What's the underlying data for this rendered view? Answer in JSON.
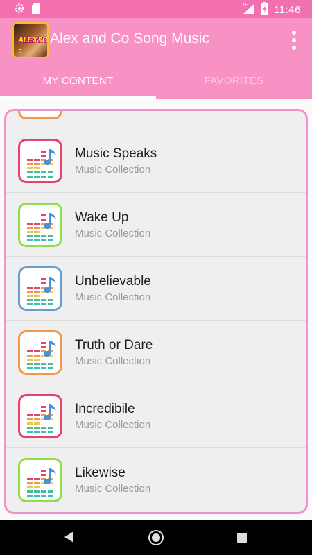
{
  "status_bar": {
    "time": "11:46",
    "network_label": "LTE",
    "icons": [
      "gear-icon",
      "sd-card-icon",
      "lte-signal-icon",
      "battery-charging-icon"
    ]
  },
  "app_bar": {
    "title": "Alex and Co Song Music",
    "logo_text": "ALEX&CO",
    "logo_note": "♫"
  },
  "tabs": [
    {
      "label": "MY CONTENT",
      "active": true
    },
    {
      "label": "FAVORITES",
      "active": false
    }
  ],
  "songs": [
    {
      "title": "Music Speaks",
      "subtitle": "Music Collection",
      "border_color": "#e8426b"
    },
    {
      "title": "Wake Up",
      "subtitle": "Music Collection",
      "border_color": "#8ee04a"
    },
    {
      "title": "Unbelievable",
      "subtitle": "Music Collection",
      "border_color": "#6b9ed0"
    },
    {
      "title": "Truth or Dare",
      "subtitle": "Music Collection",
      "border_color": "#ef9a4a"
    },
    {
      "title": "Incredibile",
      "subtitle": "Music Collection",
      "border_color": "#e8426b"
    },
    {
      "title": "Likewise",
      "subtitle": "Music Collection",
      "border_color": "#8ee04a"
    }
  ],
  "colors": {
    "primary": "#f892c4",
    "status_bar": "#f26fb0",
    "frame_border": "#f392c6"
  }
}
